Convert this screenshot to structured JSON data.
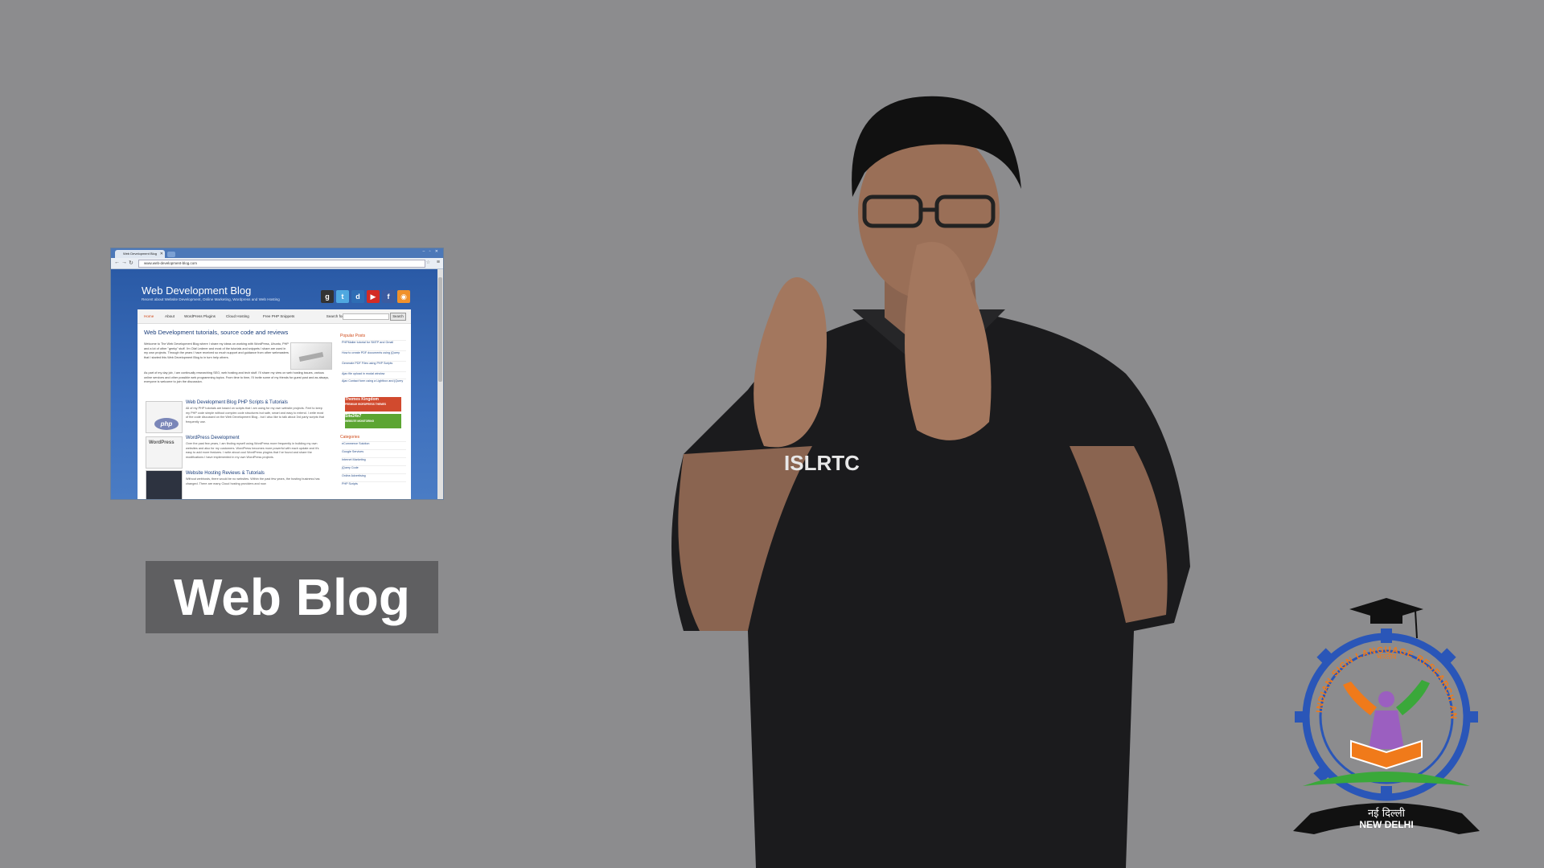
{
  "browser": {
    "tab_title": "Web Development Blog",
    "url": "www.web-development-blog.com",
    "site": {
      "title": "Web Development Blog",
      "tagline": "Recent about Website Development, Online Marketing, Wordpress and Web Hosting",
      "nav": [
        "Home",
        "About",
        "WordPress Plugins",
        "Cloud Hosting",
        "Free PHP Snippets"
      ],
      "search_label": "Search for",
      "search_button": "Search",
      "heading": "Web Development tutorials, source code and reviews",
      "intro": "Welcome to The Web Development Blog where I share my ideas on working with WordPress, Ubuntu, PHP and a lot of other \"geeky\" stuff. I'm Olaf Lederer and most of the tutorials and snippets I share are used in my own projects. Through the years I have received so much support and guidance from other webmasters that I started this Web Development Blog to in turn help others.",
      "intro2": "As part of my day job, I am continually researching SEO, web hosting and tech stuff. I'll share my view on web hosting issues, various online services and other possible web programming topics. From time to time, I'll invite some of my friends for guest post and as always, everyone is welcome to join the discussion.",
      "posts": [
        {
          "title": "Web Development Blog PHP Scripts & Tutorials",
          "body": "All of my PHP tutorials are based on scripts that I am using for my own website projects. Feel to keep my PHP code simple without complex code structures but safe, smart and easy to extend. I write most of the code discussed on the Web Development Blog - but I also like to talk about 3rd party scripts that frequently use.",
          "thumb": "php"
        },
        {
          "title": "WordPress Development",
          "body": "Over the past few years, I am finding myself using WordPress more frequently in building my own websites and also for my customers. WordPress becomes more powerful with each update and it's easy to add more features. I write about cool WordPress plugins that I've found and share the modifications I have implemented in my own WordPress projects.",
          "thumb": "WordPress"
        },
        {
          "title": "Website Hosting Reviews & Tutorials",
          "body": "Without webhosts, there would be no websites. Within the past few years, the hosting business has changed. There are many Cloud hosting providers and now",
          "thumb": ""
        }
      ],
      "popular_posts_title": "Popular Posts",
      "popular_posts": [
        "PHPMailer tutorial for SMTP and Gmail",
        "How to create PDF documents using jQuery",
        "Generate PDF Files using PHP Scripts",
        "Ajax file upload in modal window",
        "Ajax Contact form using a Lightbox and jQuery"
      ],
      "ads": [
        {
          "name": "Themes Kingdom",
          "tag": "PREMIUM WORDPRESS THEMES",
          "color": "#d14a2e"
        },
        {
          "name": "Site24x7",
          "tag": "WEBSITE MONITORING",
          "color": "#5ca532"
        }
      ],
      "categories_title": "Categories",
      "categories": [
        "eCommerce Solution",
        "Google Services",
        "Internet Marketing",
        "jQuery Code",
        "Online Advertising",
        "PHP Scripts"
      ]
    }
  },
  "caption": "Web Blog",
  "shirt_text": "ISLRTC",
  "logo": {
    "ring_text": "INDIAN SIGN LANGUAGE RESEARCH AND TRAINING CENTRE",
    "hindi_top": "भारतीय",
    "city_hindi": "नई दिल्ली",
    "city": "NEW DELHI"
  },
  "colors": {
    "background": "#8c8c8e",
    "caption_bg": "#5f5f61",
    "logo_gear": "#2a56b8",
    "logo_orange": "#f07a1a",
    "logo_green": "#3aa83a"
  }
}
